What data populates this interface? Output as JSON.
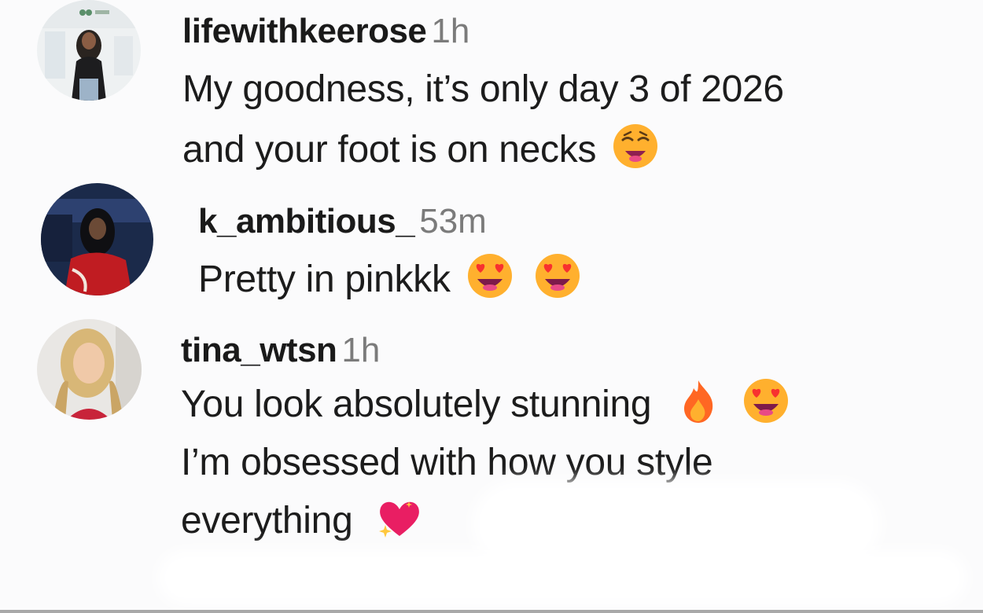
{
  "comments": [
    {
      "username": "lifewithkeerose",
      "time": "1h",
      "lines": [
        "My goodness, it’s only day 3 of 2026",
        "and your foot is on necks"
      ],
      "avatar_icon": "profile-photo",
      "emoji": [
        "weary-face"
      ]
    },
    {
      "username": "k_ambitious_",
      "time": "53m",
      "lines": [
        "Pretty in pinkkk"
      ],
      "avatar_icon": "profile-photo",
      "emoji": [
        "smiling-face-with-heart-eyes",
        "smiling-face-with-heart-eyes"
      ]
    },
    {
      "username": "tina_wtsn",
      "time": "1h",
      "lines": [
        "You look absolutely stunning",
        "I’m obsessed with how you style",
        "everything"
      ],
      "avatar_icon": "profile-photo",
      "emoji": [
        "fire",
        "smiling-face-with-heart-eyes",
        "sparkling-heart"
      ]
    }
  ],
  "colors": {
    "background": "#fbfbfc",
    "username": "#1a1a1a",
    "timestamp": "#7b7b7b",
    "text": "#1c1c1c"
  }
}
